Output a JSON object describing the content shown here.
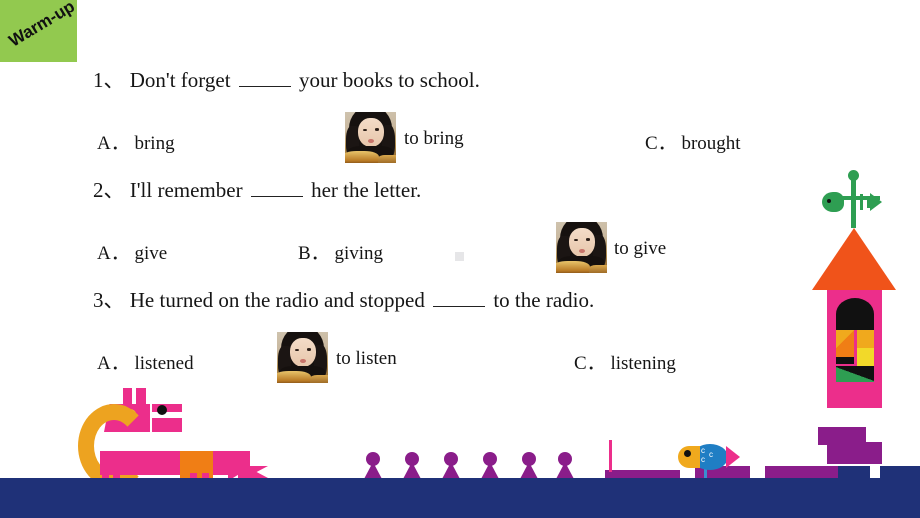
{
  "slide": {
    "badge_label": "Warm-up",
    "badge_color": "#92c94f",
    "background": "#ffffff",
    "footer_band_color": "#1f3178"
  },
  "questions": [
    {
      "number": "1、",
      "text_before": "Don't forget",
      "text_after": "your books to school.",
      "options": [
        {
          "label": "A．",
          "text": "bring",
          "is_photo": false
        },
        {
          "label": "",
          "text": "to bring",
          "is_photo": true,
          "photo_name": "girl-photo-thumbnail"
        },
        {
          "label": "C．",
          "text": "brought",
          "is_photo": false
        }
      ]
    },
    {
      "number": "2、",
      "text_before": "I'll remember",
      "text_after": "her the letter.",
      "options": [
        {
          "label": "A．",
          "text": "give",
          "is_photo": false
        },
        {
          "label": "B．",
          "text": "giving",
          "is_photo": false
        },
        {
          "label": "",
          "text": "to give",
          "is_photo": true,
          "photo_name": "girl-photo-thumbnail"
        }
      ]
    },
    {
      "number": "3、",
      "text_before": "He turned on the radio and stopped",
      "text_after": "to the radio.",
      "options": [
        {
          "label": "A．",
          "text": "listened",
          "is_photo": false
        },
        {
          "label": "",
          "text": "to listen",
          "is_photo": true,
          "photo_name": "girl-photo-thumbnail"
        },
        {
          "label": "C．",
          "text": "listening",
          "is_photo": false
        }
      ]
    }
  ],
  "decorations": {
    "dog": {
      "name": "pink-dog-illustration",
      "body_color": "#ec2e8b",
      "collar_color": "#eda320",
      "patch_color": "#f07e15"
    },
    "cones": {
      "name": "purple-cone-row",
      "count": 6,
      "color": "#8a1d8a"
    },
    "castle": {
      "name": "castle-battlements",
      "purple": "#8a1d8a",
      "navy": "#1f3178"
    },
    "fish": {
      "name": "blue-fish-on-stick",
      "head_color": "#f0a91d",
      "body_color": "#1f7ec4",
      "tail_color": "#ec2e8b",
      "scale_marks": "c c c"
    },
    "tower": {
      "name": "pink-tower-illustration",
      "roof_color": "#f0531a",
      "body_color": "#ec2e8b",
      "base_color": "#8a1d8a",
      "weathervane_color": "#2e9e52"
    }
  }
}
